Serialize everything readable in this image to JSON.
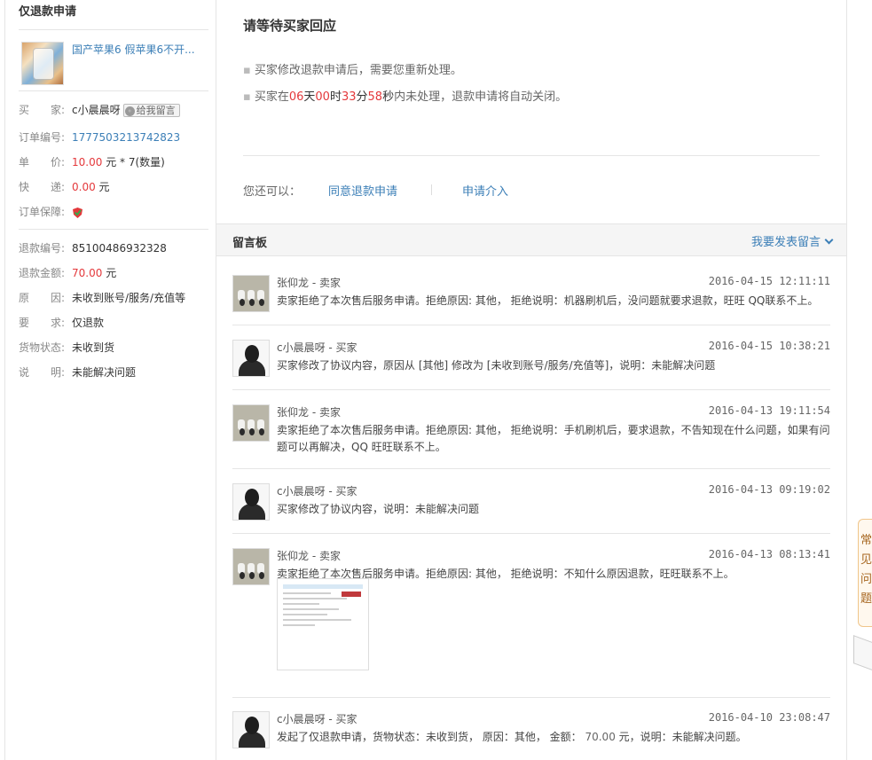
{
  "left": {
    "title": "仅退款申请",
    "product_name": "国产苹果6 假苹果6不开...",
    "fields": {
      "buyer_label": "买　　家:",
      "buyer_value": "c小晨晨呀",
      "leave_msg": "给我留言",
      "order_label": "订单编号:",
      "order_value": "1777503213742823",
      "price_label": "单　　价:",
      "price_value": "10.00",
      "price_suffix": "元 * 7(数量)",
      "ship_label": "快　　递:",
      "ship_value": "0.00",
      "ship_suffix": "元",
      "guarantee_label": "订单保障:",
      "refund_no_label": "退款编号:",
      "refund_no_value": "85100486932328",
      "refund_amt_label": "退款金额:",
      "refund_amt_value": "70.00",
      "refund_amt_suffix": "元",
      "reason_label": "原　　因:",
      "reason_value": "未收到账号/服务/充值等",
      "request_label": "要　　求:",
      "request_value": "仅退款",
      "goods_label": "货物状态:",
      "goods_value": "未收到货",
      "note_label": "说　　明:",
      "note_value": "未能解决问题"
    }
  },
  "right": {
    "title": "请等待买家回应",
    "bullet1": "买家修改退款申请后，需要您重新处理。",
    "countdown": {
      "prefix": "买家在",
      "days": "06",
      "days_unit": "天",
      "hours": "00",
      "hours_unit": "时",
      "minutes": "33",
      "minutes_unit": "分",
      "seconds": "58",
      "seconds_unit": "秒",
      "suffix": "内未处理，退款申请将自动关闭。"
    },
    "you_can": "您还可以：",
    "action_agree": "同意退款申请",
    "action_intervene": "申请介入"
  },
  "board": {
    "title": "留言板",
    "post": "我要发表留言",
    "messages": [
      {
        "who": "张仰龙 - 卖家",
        "time": "2016-04-15 12:11:11",
        "text": "卖家拒绝了本次售后服务申请。拒绝原因: 其他， 拒绝说明：机器刷机后，没问题就要求退款，旺旺 QQ联系不上。"
      },
      {
        "who": "c小晨晨呀 - 买家",
        "time": "2016-04-15 10:38:21",
        "text": "买家修改了协议内容，原因从 [其他] 修改为 [未收到账号/服务/充值等]，说明：未能解决问题"
      },
      {
        "who": "张仰龙 - 卖家",
        "time": "2016-04-13 19:11:54",
        "text": "卖家拒绝了本次售后服务申请。拒绝原因: 其他， 拒绝说明：手机刷机后，要求退款，不告知现在什么问题，如果有问题可以再解决，QQ 旺旺联系不上。"
      },
      {
        "who": "c小晨晨呀 - 买家",
        "time": "2016-04-13 09:19:02",
        "text": "买家修改了协议内容，说明：未能解决问题"
      },
      {
        "who": "张仰龙 - 卖家",
        "time": "2016-04-13 08:13:41",
        "text": "卖家拒绝了本次售后服务申请。拒绝原因: 其他， 拒绝说明：不知什么原因退款，旺旺联系不上。"
      },
      {
        "who": "c小晨晨呀 - 买家",
        "time": "2016-04-10 23:08:47",
        "text_pre": "发起了仅退款申请，货物状态：未收到货， 原因：其他， 金额：",
        "amount": "70.00",
        "text_post": "元，说明：未能解决问题。"
      }
    ]
  },
  "float_widget": {
    "chars": [
      "常",
      "见",
      "问",
      "题"
    ]
  },
  "colors": {
    "accent_blue": "#3c7fb7",
    "price_red": "#e4393c"
  },
  "icons": [
    "shield-icon",
    "chevron-down-icon",
    "message-icon"
  ]
}
